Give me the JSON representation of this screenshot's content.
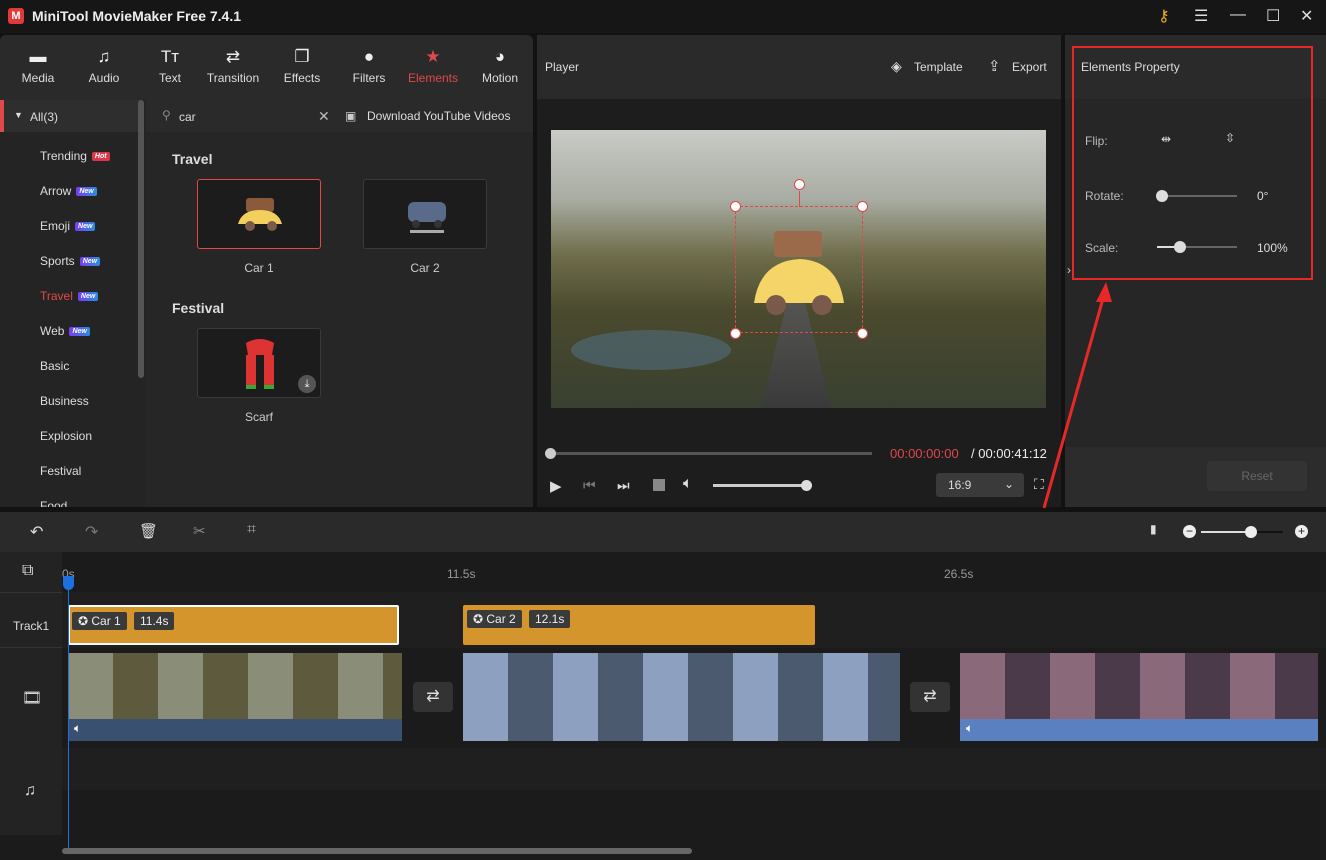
{
  "app": {
    "title": "MiniTool MovieMaker Free 7.4.1"
  },
  "tabs": [
    {
      "label": "Media",
      "icon": "folder-icon"
    },
    {
      "label": "Audio",
      "icon": "music-icon"
    },
    {
      "label": "Text",
      "icon": "text-icon"
    },
    {
      "label": "Transition",
      "icon": "transition-icon"
    },
    {
      "label": "Effects",
      "icon": "effects-icon"
    },
    {
      "label": "Filters",
      "icon": "filters-icon"
    },
    {
      "label": "Elements",
      "icon": "elements-icon",
      "active": true
    },
    {
      "label": "Motion",
      "icon": "motion-icon"
    }
  ],
  "sidebar": {
    "all": "All(3)",
    "items": [
      {
        "label": "Trending",
        "badge": "Hot"
      },
      {
        "label": "Arrow",
        "badge": "New"
      },
      {
        "label": "Emoji",
        "badge": "New"
      },
      {
        "label": "Sports",
        "badge": "New"
      },
      {
        "label": "Travel",
        "badge": "New",
        "active": true
      },
      {
        "label": "Web",
        "badge": "New"
      },
      {
        "label": "Basic"
      },
      {
        "label": "Business"
      },
      {
        "label": "Explosion"
      },
      {
        "label": "Festival"
      },
      {
        "label": "Food"
      }
    ]
  },
  "search": {
    "value": "car",
    "download": "Download YouTube Videos"
  },
  "groups": [
    {
      "title": "Travel",
      "items": [
        "Car 1",
        "Car 2"
      ]
    },
    {
      "title": "Festival",
      "items": [
        "Scarf"
      ]
    }
  ],
  "player": {
    "title": "Player",
    "template": "Template",
    "export": "Export",
    "current_time": "00:00:00:00",
    "total_time": "/ 00:00:41:12",
    "aspect": "16:9",
    "progress": 0,
    "volume": 1.0
  },
  "properties": {
    "title": "Elements Property",
    "flip": "Flip:",
    "rotate": "Rotate:",
    "rotate_value": "0°",
    "scale": "Scale:",
    "scale_value": "100%",
    "reset": "Reset",
    "rotate_level": 0,
    "scale_level": 0.3
  },
  "timeline": {
    "ruler": [
      "0s",
      "11.5s",
      "26.5s"
    ],
    "track1": "Track1",
    "clips": [
      {
        "name": "Car 1",
        "duration": "11.4s"
      },
      {
        "name": "Car 2",
        "duration": "12.1s"
      }
    ],
    "zoom_level": 0.6
  },
  "colors": {
    "accent": "#e0484a",
    "clip": "#d4962c",
    "playhead": "#1e6fe0"
  }
}
